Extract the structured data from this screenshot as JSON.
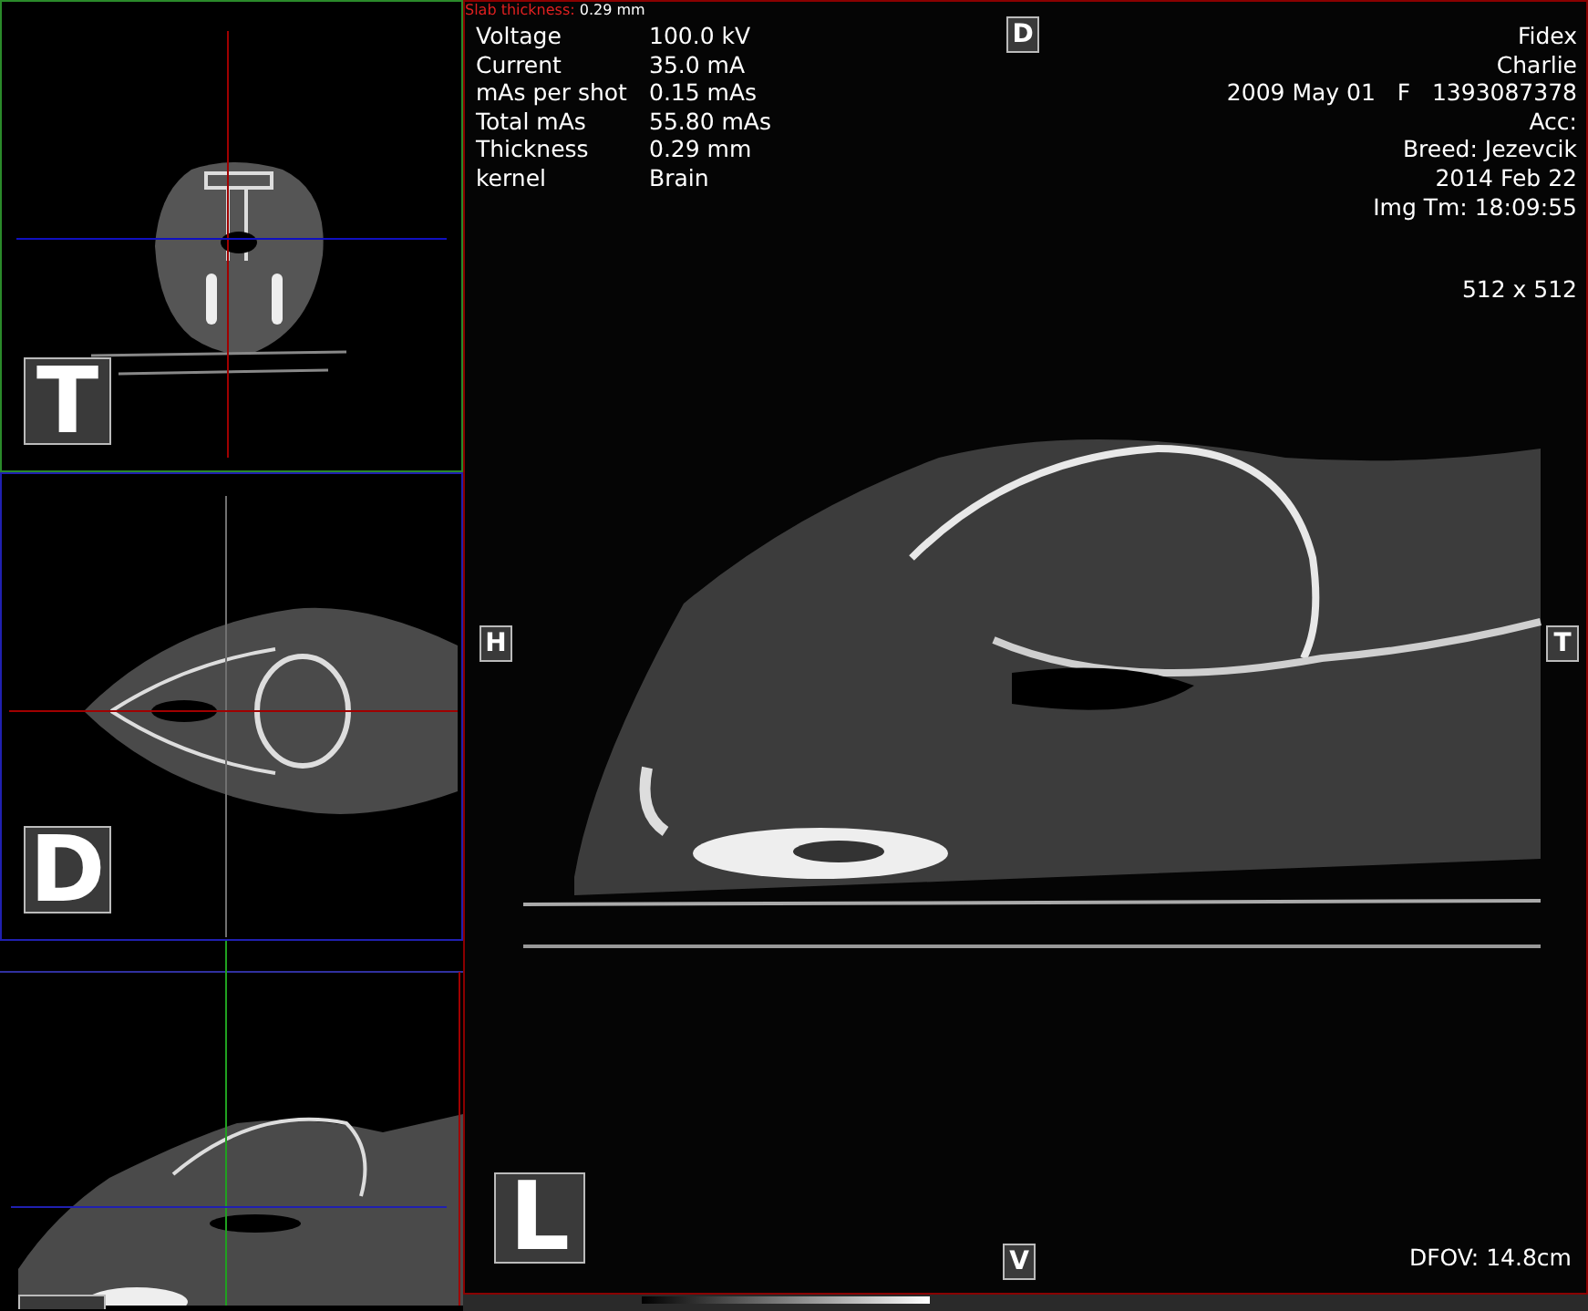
{
  "slab_thickness": {
    "label": "Slab thickness:",
    "value": "0.29 mm"
  },
  "scan_parameters": [
    {
      "label": "Voltage",
      "value": "100.0 kV"
    },
    {
      "label": "Current",
      "value": "35.0 mA"
    },
    {
      "label": "mAs per shot",
      "value": "0.15 mAs"
    },
    {
      "label": "Total mAs",
      "value": "55.80 mAs"
    },
    {
      "label": "Thickness",
      "value": "0.29 mm"
    },
    {
      "label": "kernel",
      "value": "Brain"
    }
  ],
  "patient_info": [
    "Fidex",
    "Charlie",
    "2009 May 01   F   1393087378",
    "Acc:",
    "Breed: Jezevcik",
    "2014 Feb 22",
    "Img Tm: 18:09:55"
  ],
  "matrix": "512 x 512",
  "dfov": "DFOV: 14.8cm",
  "orientation_markers": {
    "top": "D",
    "left": "H",
    "right": "T",
    "bottom": "V"
  },
  "view_label": "L",
  "thumbnails": [
    {
      "kind": "transverse",
      "label": "T"
    },
    {
      "kind": "dorsal",
      "label": "D"
    },
    {
      "kind": "sagittal"
    }
  ]
}
